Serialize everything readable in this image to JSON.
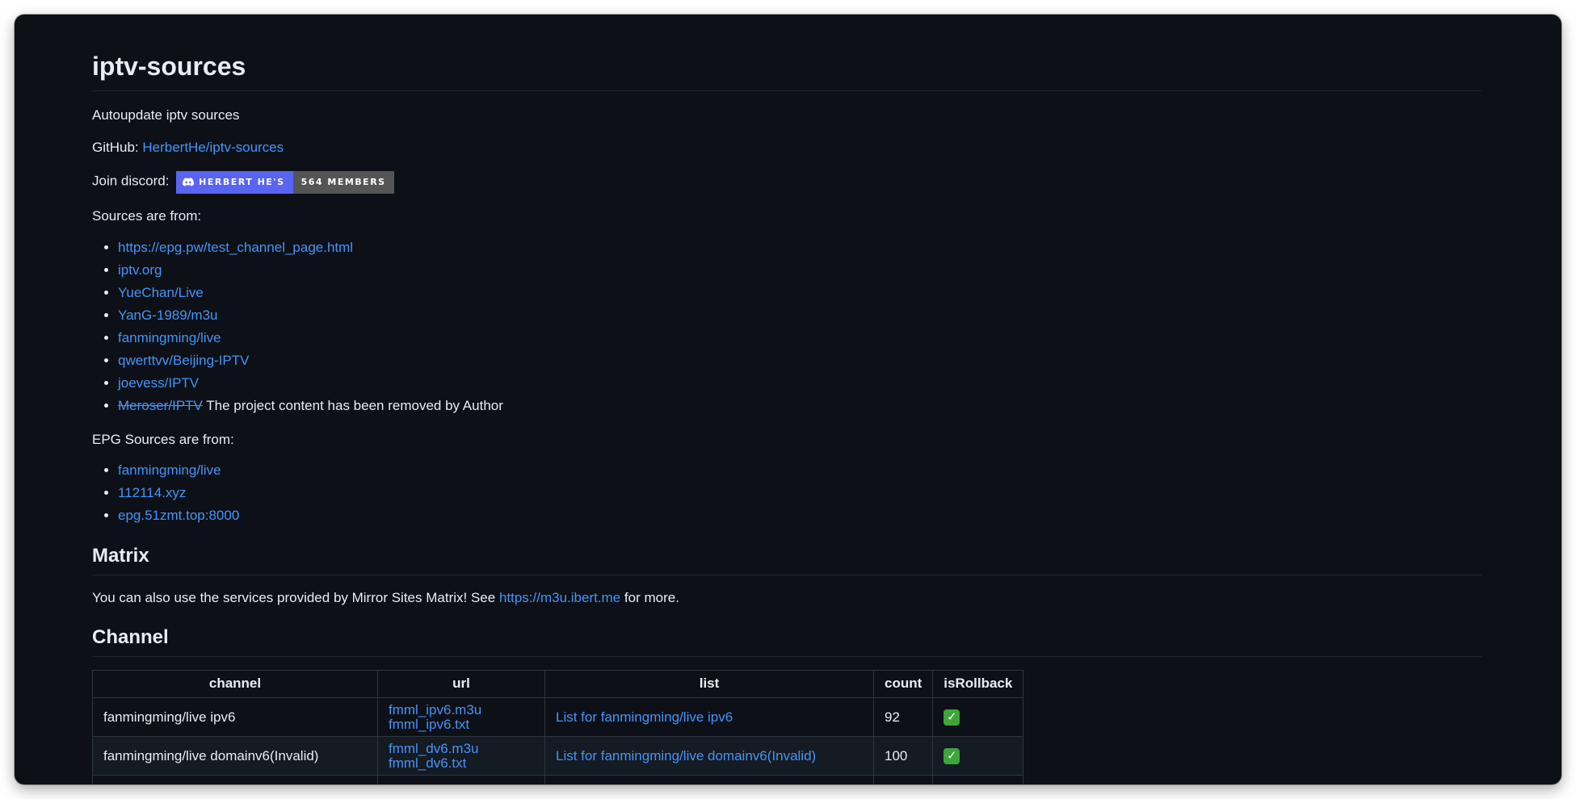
{
  "title": "iptv-sources",
  "description": "Autoupdate iptv sources",
  "github": {
    "label": "GitHub:",
    "link_text": "HerbertHe/iptv-sources"
  },
  "discord": {
    "label": "Join discord:",
    "badge_left": "HERBERT HE'S",
    "badge_right": "564 MEMBERS",
    "badge_color": "#5865f2"
  },
  "sources": {
    "heading": "Sources are from:",
    "items": [
      "https://epg.pw/test_channel_page.html",
      "iptv.org",
      "YueChan/Live",
      "YanG-1989/m3u",
      "fanmingming/live",
      "qwerttvv/Beijing-IPTV",
      "joevess/IPTV"
    ],
    "removed": {
      "link_text": "Meroser/IPTV",
      "note": "The project content has been removed by Author"
    }
  },
  "epg": {
    "heading": "EPG Sources are from:",
    "items": [
      "fanmingming/live",
      "112114.xyz",
      "epg.51zmt.top:8000"
    ]
  },
  "matrix": {
    "heading": "Matrix",
    "text_before": "You can also use the services provided by Mirror Sites Matrix! See ",
    "link_text": "https://m3u.ibert.me",
    "text_after": " for more."
  },
  "channel": {
    "heading": "Channel",
    "columns": [
      "channel",
      "url",
      "list",
      "count",
      "isRollback"
    ],
    "rows": [
      {
        "channel": "fanmingming/live ipv6",
        "url_m3u": "fmml_ipv6.m3u",
        "url_txt": "fmml_ipv6.txt",
        "list": "List for fanmingming/live ipv6",
        "count": "92",
        "is_rollback": "✓"
      },
      {
        "channel": "fanmingming/live domainv6(Invalid)",
        "url_m3u": "fmml_dv6.m3u",
        "url_txt": "fmml_dv6.txt",
        "list": "List for fanmingming/live domainv6(Invalid)",
        "count": "100",
        "is_rollback": "✓"
      }
    ]
  },
  "colors": {
    "background": "#0d1117",
    "text": "#e6edf3",
    "link": "#4493f8",
    "check": "#3da639"
  }
}
